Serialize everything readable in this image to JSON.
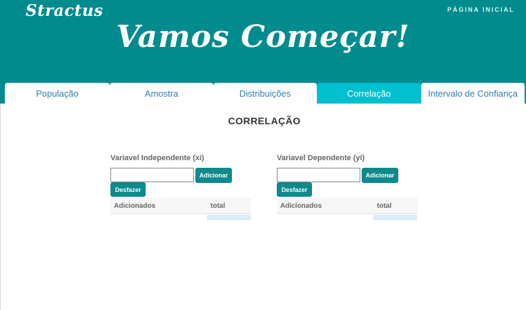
{
  "header": {
    "logo": "Stractus",
    "home_link": "PÁGINA INICIAL",
    "title": "Vamos Começar!"
  },
  "tabs": [
    {
      "label": "População",
      "active": false
    },
    {
      "label": "Amostra",
      "active": false
    },
    {
      "label": "Distribuições",
      "active": false
    },
    {
      "label": "Correlação",
      "active": true
    },
    {
      "label": "Intervalo de Confiança",
      "active": false
    }
  ],
  "section": {
    "title": "CORRELAÇÃO"
  },
  "panels": {
    "independent": {
      "label": "Variavel Independente (xi)",
      "input_value": "",
      "add_label": "Adicionar",
      "undo_label": "Desfazer",
      "col_added": "Adicionados",
      "col_total": "total"
    },
    "dependent": {
      "label": "Variavel Dependente (yi)",
      "input_value": "",
      "add_label": "Adicionar",
      "undo_label": "Desfazer",
      "col_added": "Adicionados",
      "col_total": "total"
    }
  },
  "colors": {
    "header_bg": "#008b8f",
    "active_tab": "#00bfcf",
    "button": "#0e8a8c",
    "tab_text": "#2f7fae"
  }
}
